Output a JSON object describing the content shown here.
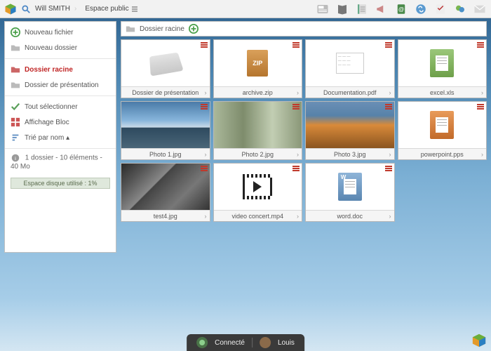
{
  "header": {
    "user": "Will SMITH",
    "space": "Espace public"
  },
  "sidebar": {
    "new_file": "Nouveau fichier",
    "new_folder": "Nouveau dossier",
    "root_folder": "Dossier racine",
    "presentation_folder": "Dossier de présentation",
    "select_all": "Tout sélectionner",
    "view_block": "Affichage Bloc",
    "sort_by_name": "Trié par nom ▴",
    "status": "1 dossier - 10 éléments - 40 Mo",
    "disk_usage": "Espace disque utilisé : 1%"
  },
  "breadcrumb": {
    "root": "Dossier racine"
  },
  "files": [
    {
      "name": "Dossier de présentation",
      "type": "folder"
    },
    {
      "name": "archive.zip",
      "type": "zip"
    },
    {
      "name": "Documentation.pdf",
      "type": "pdf"
    },
    {
      "name": "excel.xls",
      "type": "xls"
    },
    {
      "name": "Photo 1.jpg",
      "type": "photo_sky"
    },
    {
      "name": "Photo 2.jpg",
      "type": "photo_bamboo"
    },
    {
      "name": "Photo 3.jpg",
      "type": "photo_autumn"
    },
    {
      "name": "powerpoint.pps",
      "type": "pps"
    },
    {
      "name": "test4.jpg",
      "type": "photo_building"
    },
    {
      "name": "video concert.mp4",
      "type": "video"
    },
    {
      "name": "word.doc",
      "type": "doc"
    }
  ],
  "dock": {
    "status": "Connecté",
    "user": "Louis"
  }
}
